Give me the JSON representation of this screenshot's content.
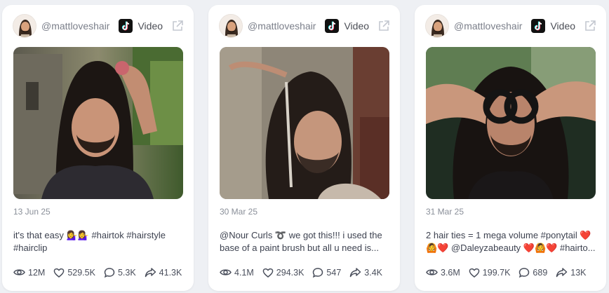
{
  "cards": [
    {
      "username": "@mattloveshair",
      "platform": "Video",
      "platform_icon": "tiktok-icon",
      "date": "13 Jun 25",
      "caption": "it's that easy 💁‍♀️💁‍♀️ #hairtok #hairstyle #hairclip",
      "stats": {
        "views": "12M",
        "likes": "529.5K",
        "comments": "5.3K",
        "shares": "41.3K"
      }
    },
    {
      "username": "@mattloveshair",
      "platform": "Video",
      "platform_icon": "tiktok-icon",
      "date": "30 Mar 25",
      "caption": "@Nour Curls ➰ we got this!!! i used the base of a paint brush but all u need is...",
      "stats": {
        "views": "4.1M",
        "likes": "294.3K",
        "comments": "547",
        "shares": "3.4K"
      }
    },
    {
      "username": "@mattloveshair",
      "platform": "Video",
      "platform_icon": "tiktok-icon",
      "date": "31 Mar 25",
      "caption": "2 hair ties = 1 mega volume #ponytail ❤️🙆❤️ @Daleyzabeauty ❤️🙆❤️ #hairto...",
      "stats": {
        "views": "3.6M",
        "likes": "199.7K",
        "comments": "689",
        "shares": "13K"
      }
    }
  ],
  "colors": {
    "page_background": "#eef0f4",
    "card_background": "#ffffff",
    "text_muted": "#7b7f8a",
    "text_body": "#3d4250"
  }
}
